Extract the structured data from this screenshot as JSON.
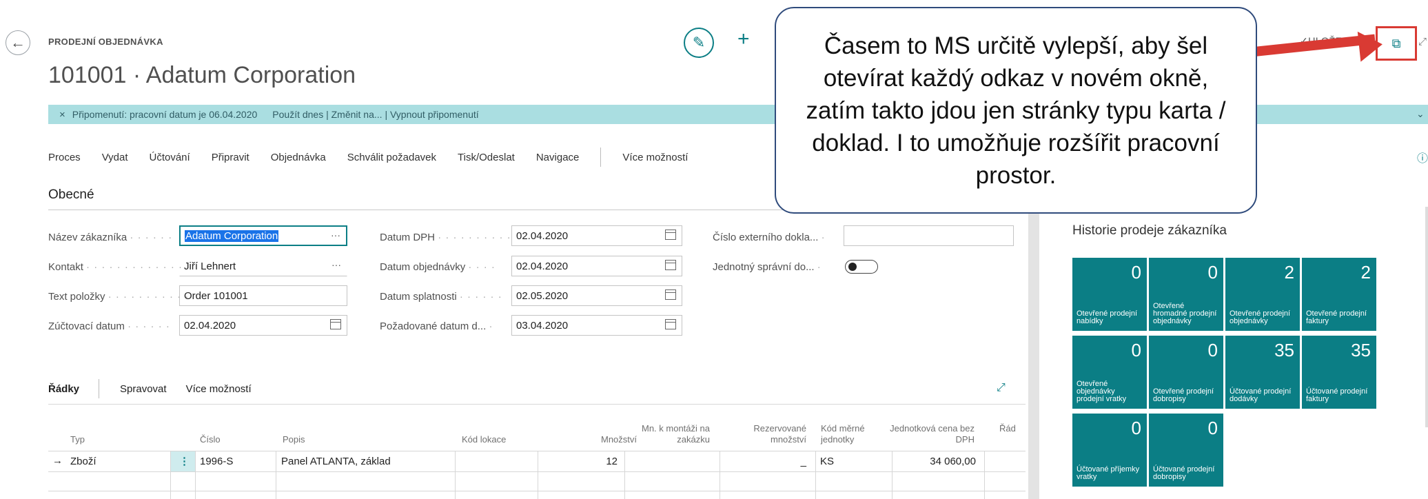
{
  "header": {
    "doc_type": "PRODEJNÍ OBJEDNÁVKA",
    "title": "101001 · Adatum Corporation",
    "saved_status": "✓ULOŽENO"
  },
  "icons": {
    "back": "←",
    "edit": "✎",
    "new": "+",
    "open_new_window": "⧉",
    "collapse": "⤢",
    "info": "ⓘ",
    "expand": "⤢",
    "chevron": "⌄",
    "dismiss": "×",
    "row_arrow": "→",
    "row_menu": "⋮"
  },
  "reminder": {
    "text": "Připomenutí: pracovní datum je 06.04.2020",
    "links": "Použít dnes | Změnit na... | Vypnout připomenutí"
  },
  "actions": [
    "Proces",
    "Vydat",
    "Účtování",
    "Připravit",
    "Objednávka",
    "Schválit požadavek",
    "Tisk/Odeslat",
    "Navigace"
  ],
  "more_options": "Více možností",
  "general": {
    "section_title": "Obecné",
    "customer_name_label": "Název zákazníka",
    "customer_name": "Adatum Corporation",
    "contact_label": "Kontakt",
    "contact": "Jiří Lehnert",
    "item_text_label": "Text položky",
    "item_text": "Order 101001",
    "posting_date_label": "Zúčtovací datum",
    "posting_date": "02.04.2020",
    "vat_date_label": "Datum DPH",
    "vat_date": "02.04.2020",
    "order_date_label": "Datum objednávky",
    "order_date": "02.04.2020",
    "due_date_label": "Datum splatnosti",
    "due_date": "02.05.2020",
    "requested_date_label": "Požadované datum d...",
    "requested_date": "03.04.2020",
    "ext_doc_label": "Číslo externího dokla...",
    "ext_doc": "",
    "admin_label": "Jednotný správní do..."
  },
  "lines": {
    "tab_lines": "Řádky",
    "tab_manage": "Spravovat",
    "tab_more": "Více možností",
    "headers": [
      "Typ",
      "Číslo",
      "Popis",
      "Kód lokace",
      "Množství",
      "Mn. k montáži na zakázku",
      "Rezervované množství",
      "Kód měrné jednotky",
      "Jednotková cena bez DPH",
      "Řád"
    ],
    "rows": [
      {
        "type": "Zboží",
        "number": "1996-S",
        "description": "Panel ATLANTA, základ",
        "location": "",
        "quantity": "12",
        "assemble": "",
        "reserved": "_",
        "uom": "KS",
        "unit_price": "34 060,00"
      }
    ]
  },
  "factbox": {
    "title": "Historie prodeje zákazníka",
    "tiles": [
      {
        "value": "0",
        "label": "Otevřené prodejní nabídky"
      },
      {
        "value": "0",
        "label": "Otevřené hromadné prodejní objednávky"
      },
      {
        "value": "2",
        "label": "Otevřené prodejní objednávky"
      },
      {
        "value": "2",
        "label": "Otevřené prodejní faktury"
      },
      {
        "value": "0",
        "label": "Otevřené objednávky prodejní vratky"
      },
      {
        "value": "0",
        "label": "Otevřené prodejní dobropisy"
      },
      {
        "value": "35",
        "label": "Účtované prodejní dodávky"
      },
      {
        "value": "35",
        "label": "Účtované prodejní faktury"
      },
      {
        "value": "0",
        "label": "Účtované příjemky vratky"
      },
      {
        "value": "0",
        "label": "Účtované prodejní dobropisy"
      }
    ]
  },
  "callout": {
    "text": "Časem to MS určitě vylepší, aby šel otevírat každý odkaz v novém okně, zatím takto jdou jen stránky typu karta / doklad. I to umožňuje rozšířit pracovní prostor."
  }
}
